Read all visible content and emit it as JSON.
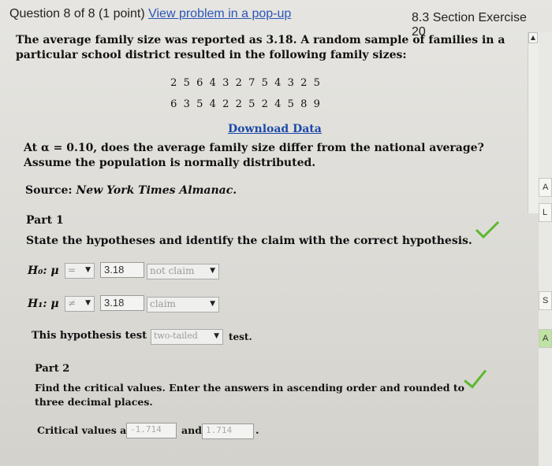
{
  "header": {
    "question_label": "Question 8 of 8 (1 point)",
    "popup_link": "View problem in a pop-up",
    "section": "8.3 Section Exercise 20"
  },
  "problem": {
    "statement": "The average family size was reported as 3.18. A random sample of families in a particular school district resulted in the following family sizes:",
    "data_row1": [
      "2",
      "5",
      "6",
      "4",
      "3",
      "2",
      "7",
      "5",
      "4",
      "3",
      "2",
      "5"
    ],
    "data_row2": [
      "6",
      "3",
      "5",
      "4",
      "2",
      "2",
      "5",
      "2",
      "4",
      "5",
      "8",
      "9"
    ],
    "download_link": "Download Data",
    "question": "At α = 0.10, does the average family size differ from the national average? Assume the population is normally distributed.",
    "source_label": "Source:",
    "source_name": "New York Times Almanac."
  },
  "part1": {
    "title": "Part 1",
    "instruction": "State the hypotheses and identify the claim with the correct hypothesis.",
    "h0_label": "H₀: μ",
    "h0_relation": "=",
    "h0_value": "3.18",
    "h0_claim": "not claim",
    "h1_label": "H₁: μ",
    "h1_relation": "≠",
    "h1_value": "3.18",
    "h1_claim": "claim",
    "test_prefix": "This hypothesis test is a",
    "test_type": "two-tailed",
    "test_suffix": "test."
  },
  "part2": {
    "title": "Part 2",
    "instruction": "Find the critical values. Enter the answers in ascending order and rounded to three decimal places.",
    "cv_prefix": "Critical values are",
    "cv1": "-1.714",
    "cv_and": "and",
    "cv2": "1.714",
    "cv_suffix": "."
  },
  "right_panel": {
    "buttons": [
      "A",
      "L",
      "S",
      "A"
    ]
  },
  "colors": {
    "link": "#2b56b8",
    "check": "#5cb82e"
  }
}
